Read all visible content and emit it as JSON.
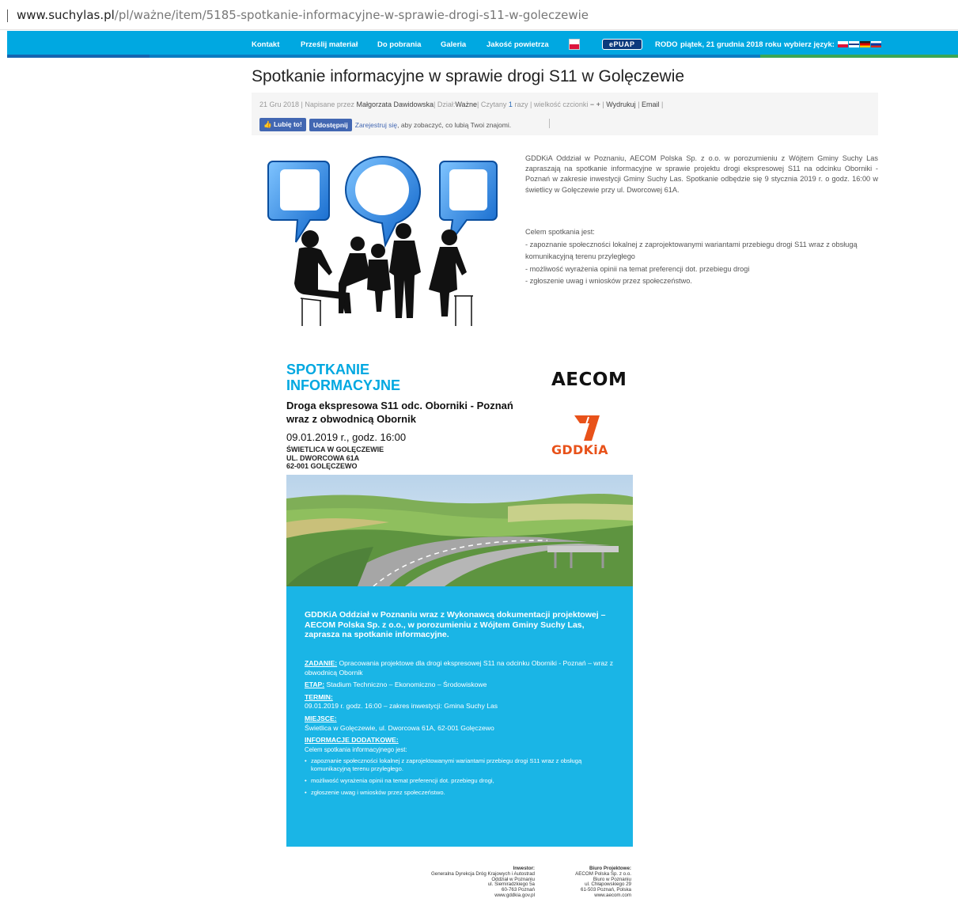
{
  "browser": {
    "url_domain": "www.suchylas.pl",
    "url_path": "/pl/ważne/item/5185-spotkanie-informacyjne-w-sprawie-drogi-s11-w-goleczewie"
  },
  "nav": {
    "kontakt": "Kontakt",
    "przeslij": "Prześlij materiał",
    "do_pobrania": "Do pobrania",
    "galeria": "Galeria",
    "jakosc": "Jakość powietrza",
    "epuap": "ePUAP",
    "rodo": "RODO",
    "date": "piątek, 21 grudnia 2018 roku",
    "lang_label": "wybierz język:"
  },
  "article": {
    "title": "Spotkanie informacyjne w sprawie drogi S11 w Golęczewie",
    "meta": {
      "date": "21 Gru 2018",
      "author_prefix": "Napisane przez",
      "author": "Małgorzata Dawidowska",
      "section_prefix": "Dział:",
      "section": "Ważne",
      "read_prefix": "Czytany",
      "read_count": "1",
      "read_suffix": "razy",
      "font_size": "wielkość czcionki",
      "font_minus": "−",
      "font_plus": "+",
      "print": "Wydrukuj",
      "email": "Email"
    },
    "social": {
      "like": "Lubię to!",
      "share": "Udostępnij",
      "register": "Zarejestruj się",
      "register_suffix": ", aby zobaczyć, co lubią Twoi znajomi."
    },
    "intro": "GDDKiA Oddział w Poznaniu, AECOM Polska Sp. z o.o. w porozumieniu z Wójtem Gminy Suchy Las zapraszają na spotkanie informacyjne w sprawie projektu drogi ekspresowej S11 na odcinku Oborniki - Poznań w zakresie inwestycji Gminy Suchy Las. Spotkanie odbędzie się 9 stycznia 2019 r. o godz. 16:00 w świetlicy w Golęczewie przy ul. Dworcowej 61A.",
    "goals_title": "Celem spotkania jest:",
    "goals": [
      "- zapoznanie społeczności lokalnej z zaprojektowanymi wariantami przebiegu drogi S11 wraz z obsługą komunikacyjną terenu przyległego",
      "- możliwość wyrażenia opinii na temat preferencji dot. przebiegu drogi",
      "- zgłoszenie uwag i wniosków przez społeczeństwo."
    ]
  },
  "poster": {
    "title1": "SPOTKANIE",
    "title2": "INFORMACYJNE",
    "sub1": "Droga ekspresowa S11 odc. Oborniki - Poznań",
    "sub2": "wraz z obwodnicą Obornik",
    "date": "09.01.2019 r., godz. 16:00",
    "addr1": "ŚWIETLICA W GOLĘCZEWIE",
    "addr2": "UL. DWORCOWA 61A",
    "addr3": "62-001 GOLĘCZEWO",
    "aecom": "AECOM",
    "gddkia": "GDDKiA",
    "lead": "GDDKiA Oddział w Poznaniu wraz z Wykonawcą dokumentacji projektowej – AECOM Polska Sp. z o.o., w porozumieniu z Wójtem Gminy Suchy Las, zaprasza na spotkanie informacyjne.",
    "zadanie_h": "ZADANIE:",
    "zadanie": " Opracowania projektowe dla drogi ekspresowej S11 na odcinku Oborniki - Poznań – wraz z obwodnicą Obornik",
    "etap_h": "ETAP:",
    "etap": " Stadium Techniczno – Ekonomiczno – Środowiskowe",
    "termin_h": "TERMIN:",
    "termin": "09.01.2019 r. godz. 16:00 – zakres inwestycji: Gmina Suchy Las",
    "miejsce_h": "MIEJSCE:",
    "miejsce": "Świetlica w Golęczewie, ul. Dworcowa 61A, 62-001 Golęczewo",
    "info_h": "INFORMACJE DODATKOWE:",
    "info": "Celem spotkania informacyjnego jest:",
    "bullets": [
      "zapoznanie społeczności lokalnej z zaprojektowanymi wariantami przebiegu drogi S11 wraz z obsługą komunikacyjną terenu przyległego.",
      "możliwość wyrażenia opinii na temat preferencji dot. przebiegu drogi,",
      "zgłoszenie uwag i wniosków przez społeczeństwo."
    ],
    "investor_h": "Inwestor:",
    "investor": "Generalna Dyrekcja Dróg Krajowych i Autostrad\nOddział w Poznaniu\nul. Siemiradzkiego 5a\n60-763 Poznań\nwww.gddkia.gov.pl",
    "biuro_h": "Biuro Projektowe:",
    "biuro": "AECOM Polska Sp. z o.o.\nBiuro w Poznaniu\nul. Chłapowskiego 29\n61-503 Poznań, Polska\nwww.aecom.com"
  },
  "colors": {
    "nav_blue": "#00a8e1",
    "poster_blue": "#1ab5e6",
    "gddkia_orange": "#e8521a"
  }
}
